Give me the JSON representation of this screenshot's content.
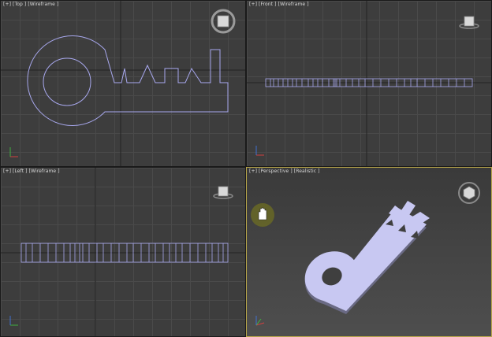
{
  "viewports": {
    "top": {
      "label": "[+] [Top ] [Wireframe ]"
    },
    "front": {
      "label": "[+] [Front ] [Wireframe ]"
    },
    "left": {
      "label": "[+] [Left ] [Wireframe ]"
    },
    "perspective": {
      "label": "[+] [Perspective ] [Realistic ]"
    }
  },
  "colors": {
    "wireframe": "#a8a8ee",
    "active_border": "#b9a74a",
    "grid_bg": "#3d3d3d",
    "key_solid": "#c8c8f2"
  },
  "icons": {
    "viewcube": "viewcube-icon",
    "axis": "axis-tripod-icon",
    "pan_cursor": "hand-cursor-icon"
  }
}
